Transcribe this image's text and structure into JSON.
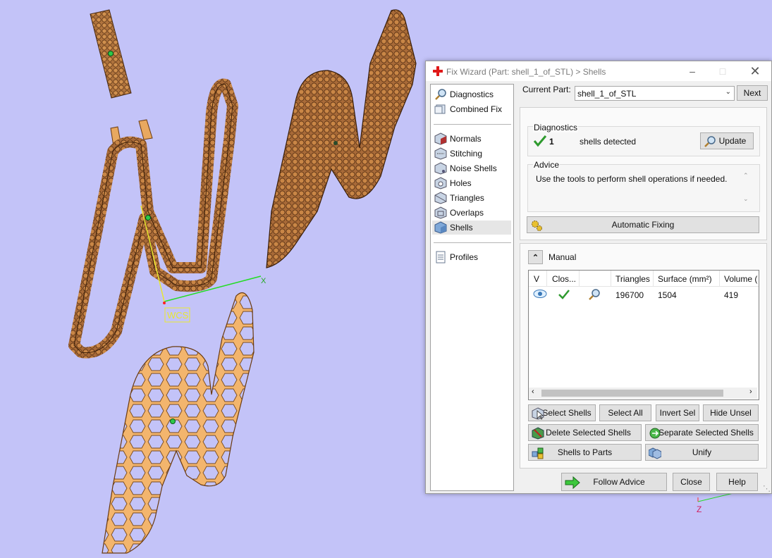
{
  "viewport": {
    "wcs_label": "WCS",
    "x_axis_label": "X",
    "z_axis_label": "Z"
  },
  "dialog": {
    "title": "Fix Wizard (Part: shell_1_of_STL) > Shells",
    "sidebar": {
      "top_items": [
        {
          "label": "Diagnostics",
          "icon": "magnifier-icon"
        },
        {
          "label": "Combined Fix",
          "icon": "combined-fix-icon"
        }
      ],
      "tool_items": [
        {
          "label": "Normals",
          "icon": "normals-cube-icon"
        },
        {
          "label": "Stitching",
          "icon": "stitching-cube-icon"
        },
        {
          "label": "Noise Shells",
          "icon": "noise-shells-cube-icon"
        },
        {
          "label": "Holes",
          "icon": "holes-cube-icon"
        },
        {
          "label": "Triangles",
          "icon": "triangles-cube-icon"
        },
        {
          "label": "Overlaps",
          "icon": "overlaps-cube-icon"
        },
        {
          "label": "Shells",
          "icon": "shells-cube-icon",
          "selected": true
        }
      ],
      "bottom_items": [
        {
          "label": "Profiles",
          "icon": "document-icon"
        }
      ]
    },
    "current_part": {
      "label": "Current Part:",
      "value": "shell_1_of_STL",
      "next_label": "Next"
    },
    "diagnostics": {
      "title": "Diagnostics",
      "count": "1",
      "text": "shells detected",
      "update_label": "Update"
    },
    "advice": {
      "title": "Advice",
      "text": "Use the tools to perform shell operations if needed."
    },
    "automatic_fixing_label": "Automatic Fixing",
    "manual": {
      "title": "Manual",
      "columns": [
        "V",
        "Clos...",
        "",
        "Triangles",
        "Surface (mm²)",
        "Volume ("
      ],
      "rows": [
        {
          "triangles": "196700",
          "surface": "1504",
          "volume": "419"
        }
      ],
      "buttons": {
        "select_shells": "Select Shells",
        "select_all": "Select All",
        "invert_sel": "Invert Sel",
        "hide_unsel": "Hide Unsel",
        "delete_selected": "Delete Selected Shells",
        "separate_selected": "Separate Selected Shells",
        "shells_to_parts": "Shells to Parts",
        "unify": "Unify"
      }
    },
    "footer": {
      "follow_advice": "Follow Advice",
      "close": "Close",
      "help": "Help"
    }
  },
  "colors": {
    "background": "#c3c3f8",
    "dark_part": "#8a5226",
    "light_part": "#f5b870",
    "check_green": "#2e9a2e"
  }
}
